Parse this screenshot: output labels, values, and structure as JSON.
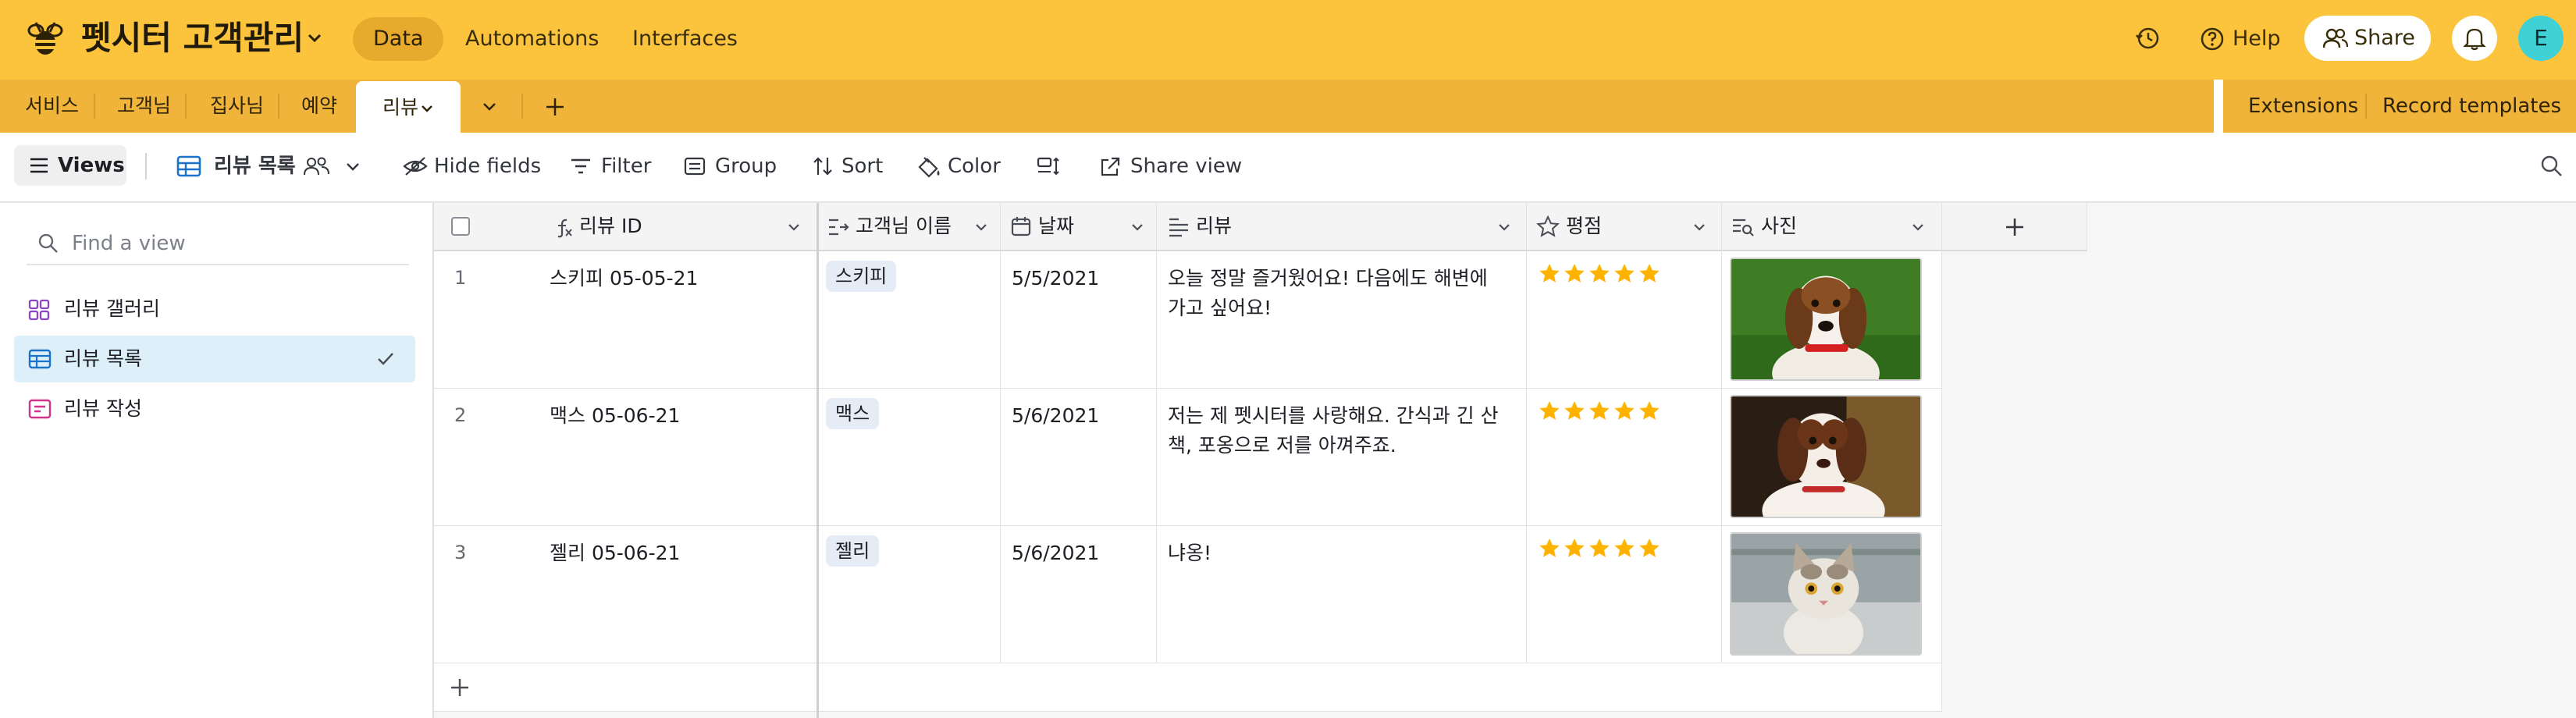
{
  "header": {
    "base_title": "펫시터 고객관리",
    "tabs": [
      "Data",
      "Automations",
      "Interfaces"
    ],
    "help_label": "Help",
    "share_label": "Share",
    "avatar_initial": "E",
    "accent_color": "#fcc43d"
  },
  "table_tabs": [
    "서비스",
    "고객님",
    "집사님",
    "예약",
    "리뷰"
  ],
  "toolbar_right": {
    "extensions": "Extensions",
    "record_templates": "Record templates"
  },
  "viewbar": {
    "views_label": "Views",
    "current_view": "리뷰 목록",
    "hide_fields": "Hide fields",
    "filter": "Filter",
    "group": "Group",
    "sort": "Sort",
    "color": "Color",
    "share_view": "Share view"
  },
  "sidebar": {
    "find_placeholder": "Find a view",
    "views": [
      {
        "label": "리뷰 갤러리",
        "icon": "gallery-icon"
      },
      {
        "label": "리뷰 목록",
        "icon": "grid-icon",
        "selected": true
      },
      {
        "label": "리뷰 작성",
        "icon": "form-icon"
      }
    ]
  },
  "grid": {
    "columns": [
      {
        "label": "리뷰 ID",
        "icon": "formula-icon"
      },
      {
        "label": "고객님 이름",
        "icon": "lookup-icon"
      },
      {
        "label": "날짜",
        "icon": "calendar-icon"
      },
      {
        "label": "리뷰",
        "icon": "long-text-icon"
      },
      {
        "label": "평점",
        "icon": "star-icon"
      },
      {
        "label": "사진",
        "icon": "attachment-icon"
      }
    ],
    "rows": [
      {
        "num": "1",
        "id": "스키피 05-05-21",
        "name": "스키피",
        "date": "5/5/2021",
        "review": "오늘 정말 즐거웠어요! 다음에도 해변에 가고 싶어요!",
        "rating": 5,
        "photo": "beagle-photo"
      },
      {
        "num": "2",
        "id": "맥스 05-06-21",
        "name": "맥스",
        "date": "5/6/2021",
        "review": "저는 제 펫시터를 사랑해요. 간식과 긴 산책, 포옹으로 저를 아껴주죠.",
        "rating": 5,
        "photo": "spaniel-photo"
      },
      {
        "num": "3",
        "id": "젤리 05-06-21",
        "name": "젤리",
        "date": "5/6/2021",
        "review": "냐옹!",
        "rating": 5,
        "photo": "kitten-photo"
      }
    ]
  }
}
